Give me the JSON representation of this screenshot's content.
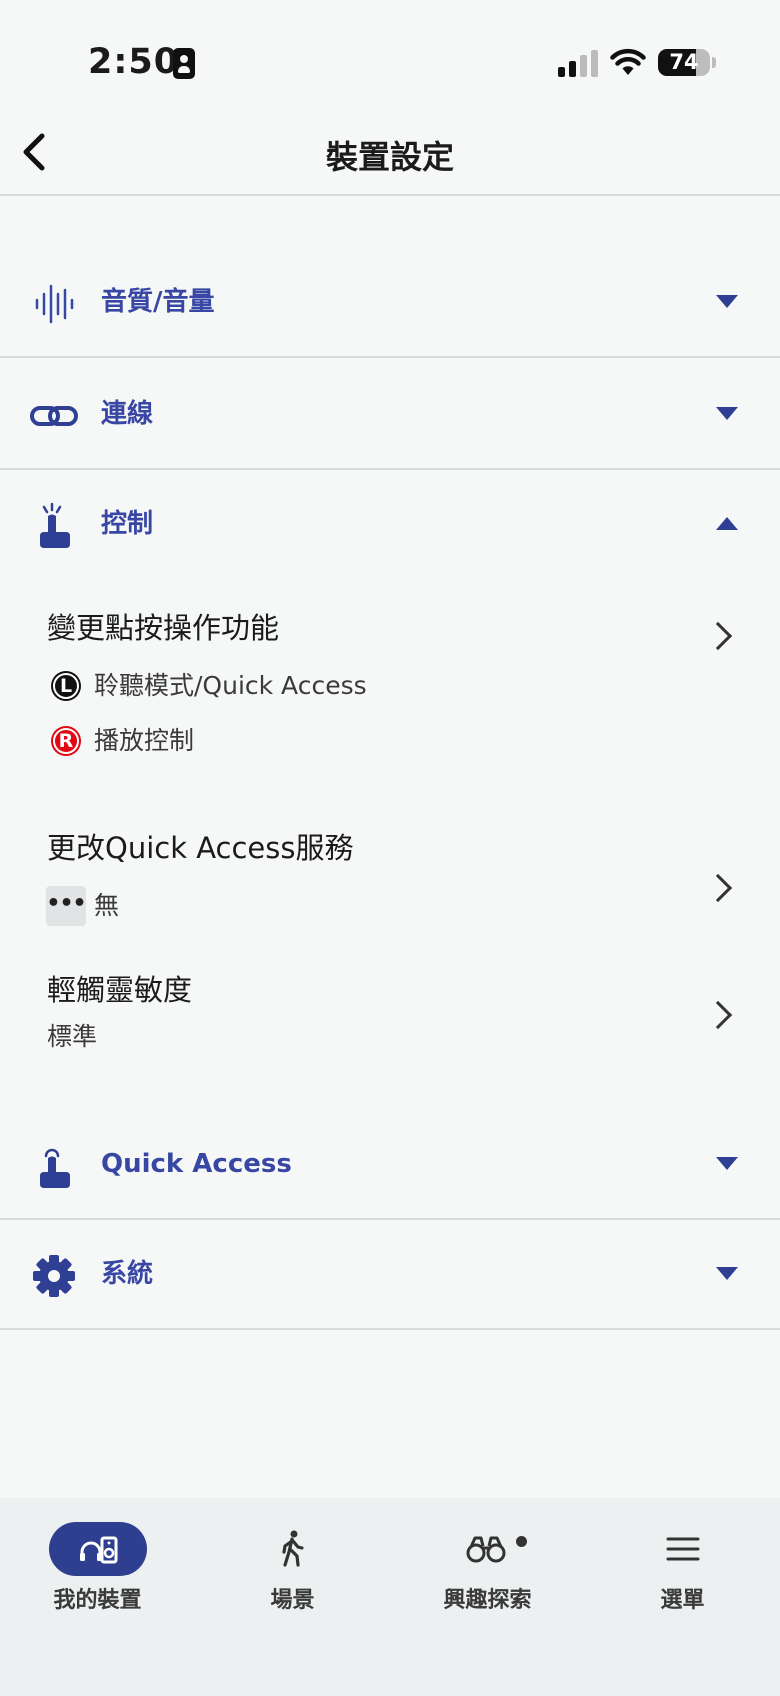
{
  "status_bar": {
    "time": "2:50",
    "battery": "74",
    "battery_level": 0.74
  },
  "nav": {
    "title": "裝置設定"
  },
  "sections": {
    "sound": {
      "label": "音質/音量"
    },
    "connection": {
      "label": "連線"
    },
    "control": {
      "label": "控制"
    },
    "quick_access": {
      "label": "Quick Access"
    },
    "system": {
      "label": "系統"
    }
  },
  "control": {
    "tap_function": {
      "title": "變更點按操作功能",
      "left_badge": "L",
      "left_value": "聆聽模式/Quick Access",
      "right_badge": "R",
      "right_value": "播放控制"
    },
    "quick_access_service": {
      "title": "更改Quick Access服務",
      "value": "無"
    },
    "touch_sensitivity": {
      "title": "輕觸靈敏度",
      "value": "標準"
    }
  },
  "tabs": [
    {
      "label": "我的裝置",
      "icon": "headphones-speaker-icon",
      "active": true
    },
    {
      "label": "場景",
      "icon": "walking-person-icon"
    },
    {
      "label": "興趣探索",
      "icon": "binoculars-icon"
    },
    {
      "label": "選單",
      "icon": "hamburger-menu-icon"
    }
  ],
  "colors": {
    "accent": "#3847a4",
    "active_tab": "#2f3f8f",
    "badge_r": "#e30613",
    "background": "#f6f8f8"
  }
}
